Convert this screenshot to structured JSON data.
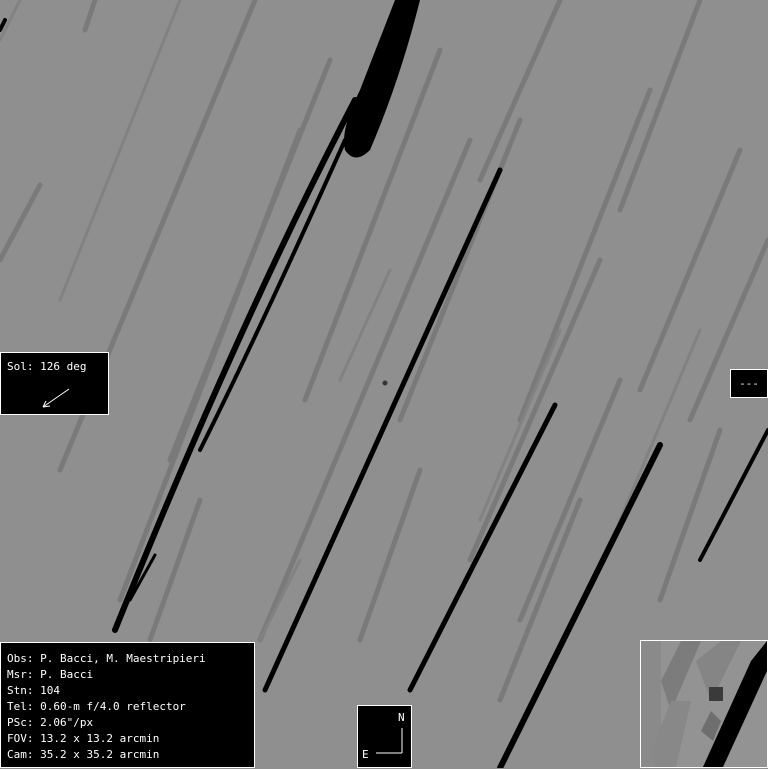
{
  "sol_panel": {
    "text": "Sol: 126 deg",
    "arrow_icon": "sun-direction-arrow-icon"
  },
  "dash_panel": {
    "text": "---"
  },
  "info": {
    "obs": "Obs: P. Bacci, M. Maestripieri",
    "msr": "Msr: P. Bacci",
    "stn": "Stn: 104",
    "tel": "Tel: 0.60-m f/4.0 reflector",
    "psc": "PSc: 2.06\"/px",
    "fov": "FOV: 13.2 x 13.2 arcmin",
    "cam": "Cam: 35.2 x 35.2 arcmin"
  },
  "compass": {
    "north": "N",
    "east": "E"
  },
  "colors": {
    "sky": "#8f8f8f",
    "streak": "#000000",
    "faint_streak": "#6e6e6e",
    "panel": "#000000",
    "panel_text": "#ffffff"
  }
}
